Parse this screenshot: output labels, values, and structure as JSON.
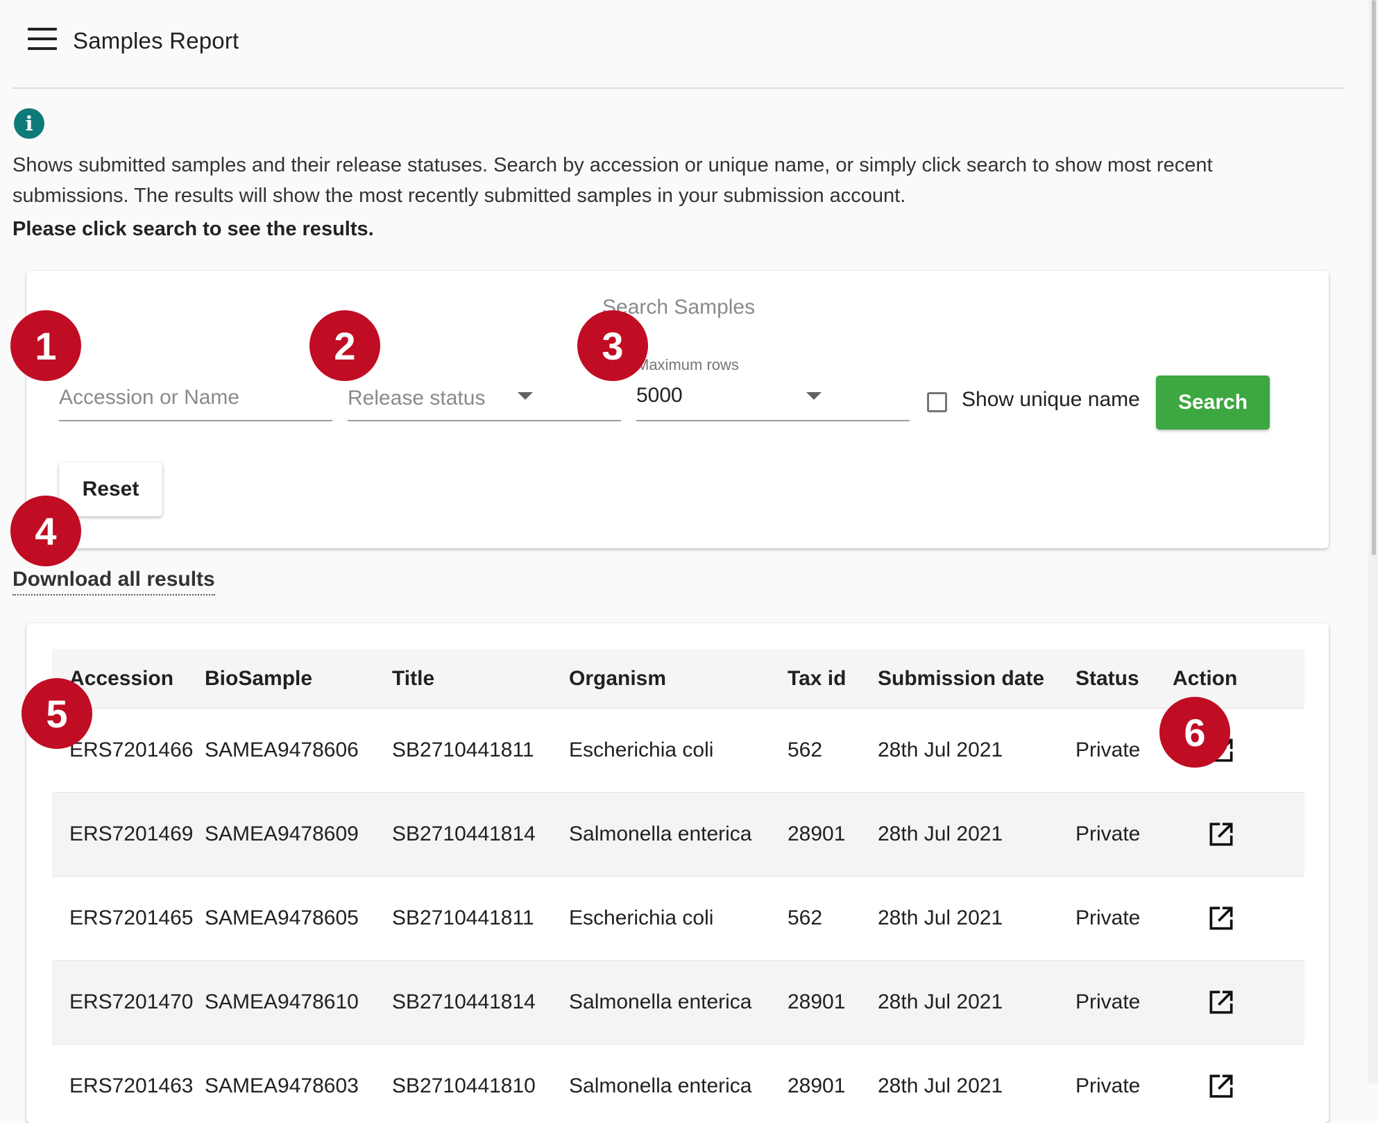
{
  "header": {
    "title": "Samples Report"
  },
  "info": {
    "line1": "Shows submitted samples and their release statuses. Search by accession or unique name, or simply click search to show most recent",
    "line2": "submissions. The results will show the most recently submitted samples in your submission account.",
    "instruction": "Please click search to see the results."
  },
  "search": {
    "title": "Search Samples",
    "accession_placeholder": "Accession or Name",
    "release_status_label": "Release status",
    "max_rows_label": "Maximum rows",
    "max_rows_value": "5000",
    "show_unique_label": "Show unique name",
    "show_unique_checked": false,
    "search_label": "Search",
    "reset_label": "Reset",
    "accent_color": "#3da742"
  },
  "download": {
    "label": "Download all results"
  },
  "table": {
    "columns": [
      "Accession",
      "BioSample",
      "Title",
      "Organism",
      "Tax id",
      "Submission date",
      "Status",
      "Action"
    ],
    "rows": [
      {
        "accession": "ERS7201466",
        "biosample": "SAMEA9478606",
        "title": "SB2710441811",
        "organism": "Escherichia coli",
        "tax_id": "562",
        "date": "28th Jul 2021",
        "status": "Private",
        "action_icon": "open-in-new-icon"
      },
      {
        "accession": "ERS7201469",
        "biosample": "SAMEA9478609",
        "title": "SB2710441814",
        "organism": "Salmonella enterica",
        "tax_id": "28901",
        "date": "28th Jul 2021",
        "status": "Private",
        "action_icon": "open-in-new-icon"
      },
      {
        "accession": "ERS7201465",
        "biosample": "SAMEA9478605",
        "title": "SB2710441811",
        "organism": "Escherichia coli",
        "tax_id": "562",
        "date": "28th Jul 2021",
        "status": "Private",
        "action_icon": "open-in-new-icon"
      },
      {
        "accession": "ERS7201470",
        "biosample": "SAMEA9478610",
        "title": "SB2710441814",
        "organism": "Salmonella enterica",
        "tax_id": "28901",
        "date": "28th Jul 2021",
        "status": "Private",
        "action_icon": "open-in-new-icon"
      },
      {
        "accession": "ERS7201463",
        "biosample": "SAMEA9478603",
        "title": "SB2710441810",
        "organism": "Salmonella enterica",
        "tax_id": "28901",
        "date": "28th Jul 2021",
        "status": "Private",
        "action_icon": "open-in-new-icon"
      }
    ]
  },
  "callouts": [
    "1",
    "2",
    "3",
    "4",
    "5",
    "6"
  ],
  "colors": {
    "info_icon": "#0f7b79",
    "callout": "#c00d23"
  },
  "icons": {
    "menu": "menu-icon",
    "info": "info-icon"
  }
}
